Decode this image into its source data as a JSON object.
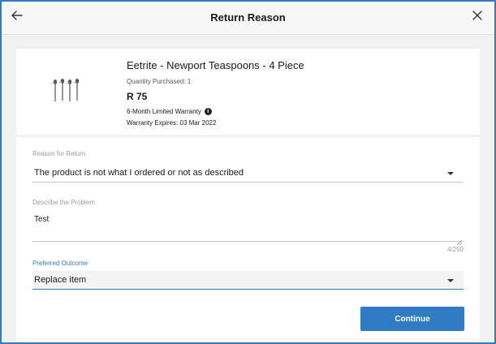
{
  "header": {
    "title": "Return Reason",
    "back_icon": "arrow-left-icon",
    "close_icon": "close-icon"
  },
  "product": {
    "name": "Eetrite - Newport Teaspoons - 4 Piece",
    "quantity": "Quantity Purchased: 1",
    "price": "R 75",
    "warranty": "6-Month Limited Warranty",
    "warranty_expiry": "Warranty Expires: 03 Mar 2022",
    "image_icon": "teaspoons-image"
  },
  "form": {
    "reason_label": "Reason for Return",
    "reason_value": "The product is not what I ordered or not as described",
    "problem_label": "Describe the Problem",
    "problem_value": "Test",
    "problem_counter": "4/250",
    "outcome_label": "Preferred Outcome",
    "outcome_value": "Replace item",
    "continue_label": "Continue"
  },
  "colors": {
    "accent": "#2f7cc4",
    "background": "#f2f2f2",
    "card": "#ffffff"
  }
}
